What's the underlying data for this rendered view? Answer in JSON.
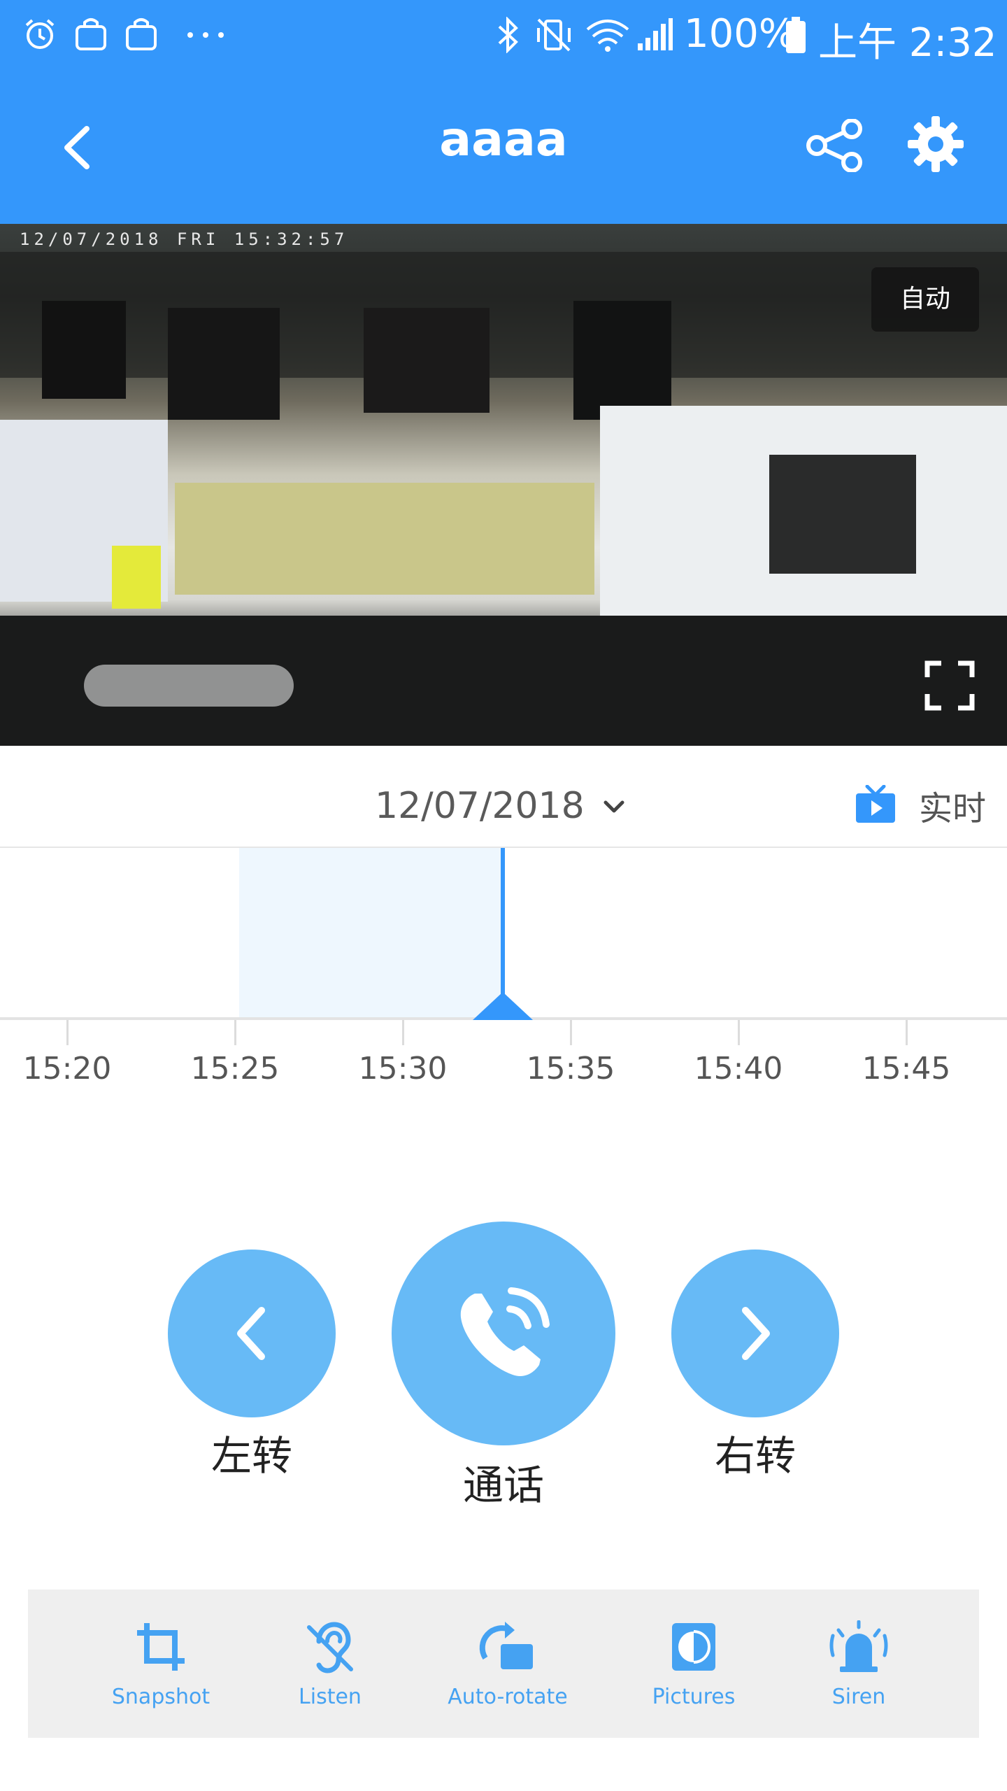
{
  "status_bar": {
    "battery": "100%",
    "time": "上午 2:32",
    "icons": [
      "alarm-icon",
      "shopping-bag-icon",
      "shopping-bag-icon",
      "more-dots-icon",
      "bluetooth-icon",
      "vibrate-mute-icon",
      "wifi-icon",
      "signal-icon",
      "battery-icon"
    ]
  },
  "header": {
    "title": "aaaa",
    "back_icon": "chevron-left-icon",
    "share_icon": "share-icon",
    "settings_icon": "gear-icon"
  },
  "camera": {
    "overlay_timestamp": "12/07/2018 FRI 15:32:57",
    "mode_badge": "自动",
    "fullscreen_icon": "fullscreen-icon"
  },
  "date_bar": {
    "date": "12/07/2018",
    "live_label": "实时"
  },
  "timeline": {
    "ticks": [
      "15:20",
      "15:25",
      "15:30",
      "15:35",
      "15:40",
      "15:45"
    ],
    "recorded_start": "15:25",
    "recorded_end": "15:33",
    "playhead_time": "15:33"
  },
  "controls": {
    "left": {
      "label": "左转",
      "icon": "chevron-left-icon"
    },
    "talk": {
      "label": "通话",
      "icon": "phone-call-icon"
    },
    "right": {
      "label": "右转",
      "icon": "chevron-right-icon"
    }
  },
  "toolbar": {
    "items": [
      {
        "label": "Snapshot",
        "icon": "crop-icon"
      },
      {
        "label": "Listen",
        "icon": "ear-icon"
      },
      {
        "label": "Auto-rotate",
        "icon": "rotate-icon"
      },
      {
        "label": "Pictures",
        "icon": "pictures-icon"
      },
      {
        "label": "Siren",
        "icon": "siren-icon"
      }
    ]
  },
  "colors": {
    "header_blue": "#3497fb",
    "control_blue": "#67baf6",
    "toolbar_text": "#45a2f2",
    "recorded_range": "#eef7fe"
  }
}
